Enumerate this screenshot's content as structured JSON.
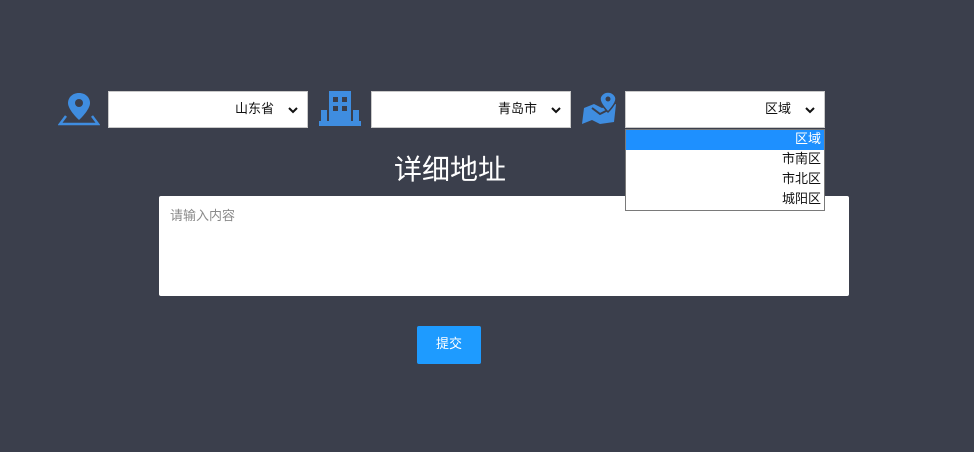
{
  "selects": {
    "province": {
      "value": "山东省"
    },
    "city": {
      "value": "青岛市"
    },
    "district": {
      "value": "区域"
    }
  },
  "district_options": [
    "区域",
    "市南区",
    "市北区",
    "城阳区"
  ],
  "district_selected_index": 0,
  "detail": {
    "title": "详细地址",
    "placeholder": "请输入内容"
  },
  "submit_label": "提交",
  "colors": {
    "background": "#3b3f4c",
    "accent": "#1e9bff",
    "icon_blue": "#1e90ff",
    "option_highlight": "#1e90ff"
  },
  "icons": [
    "map-pin-icon",
    "building-icon",
    "map-area-icon",
    "chevron-down-icon"
  ]
}
